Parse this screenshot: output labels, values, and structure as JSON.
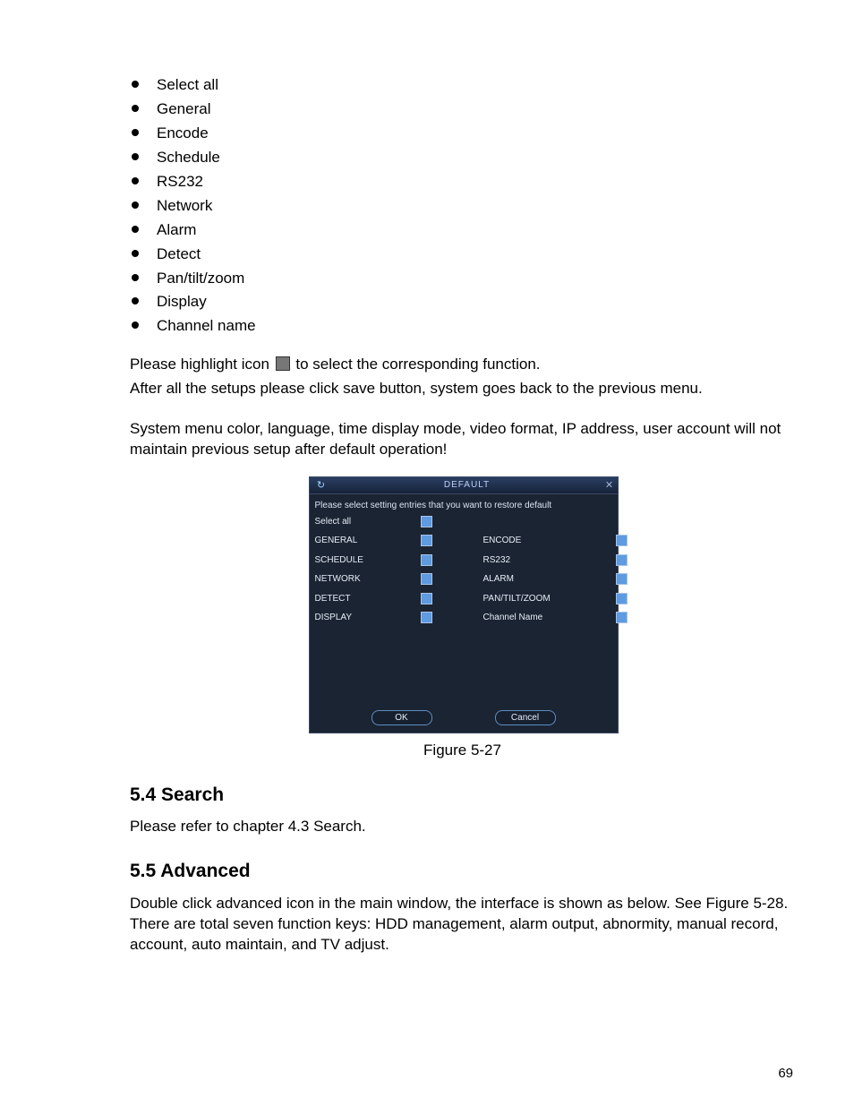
{
  "bulletItems": [
    "Select all",
    "General",
    "Encode",
    "Schedule",
    "RS232",
    "Network",
    "Alarm",
    "Detect",
    "Pan/tilt/zoom",
    "Display",
    "Channel name"
  ],
  "para1a": "Please highlight icon ",
  "para1b": " to select the corresponding function.",
  "para2": "After all the setups please click save button, system goes back to the previous menu.",
  "para3": "System menu color, language, time display mode, video format, IP address, user account will not maintain previous setup after default operation!",
  "dialog": {
    "title": "DEFAULT",
    "prompt": "Please select setting entries that you want to restore default",
    "rows": [
      {
        "left": "Select all",
        "right": ""
      },
      {
        "left": "GENERAL",
        "right": "ENCODE"
      },
      {
        "left": "SCHEDULE",
        "right": "RS232"
      },
      {
        "left": "NETWORK",
        "right": "ALARM"
      },
      {
        "left": "DETECT",
        "right": "PAN/TILT/ZOOM"
      },
      {
        "left": "DISPLAY",
        "right": "Channel Name"
      }
    ],
    "ok": "OK",
    "cancel": "Cancel"
  },
  "figureCaption": "Figure 5-27",
  "section54": {
    "heading": "5.4   Search",
    "body": "Please refer to chapter 4.3 Search."
  },
  "section55": {
    "heading": "5.5  Advanced",
    "body": "Double click advanced icon in the main window, the interface is shown as below. See Figure 5-28. There are total seven function keys: HDD management, alarm output, abnormity, manual record, account, auto maintain, and TV adjust."
  },
  "pageNumber": "69"
}
